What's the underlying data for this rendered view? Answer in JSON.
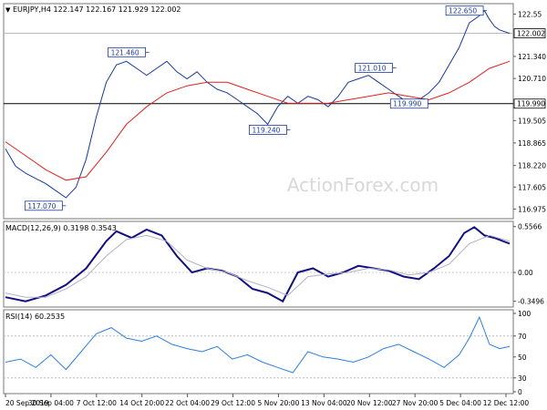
{
  "chart_data": [
    {
      "type": "line",
      "panel": "price",
      "title": "EURJPY,H4  122.147 122.167 121.929 122.002",
      "watermark": "ActionForex.com",
      "ylim": [
        116.7,
        122.85
      ],
      "y_ticks": [
        "122.55",
        "121.340",
        "120.710",
        "119.505",
        "118.865",
        "118.220",
        "117.605",
        "116.975"
      ],
      "y_tick_values": [
        122.55,
        121.34,
        120.71,
        119.505,
        118.865,
        118.22,
        117.605,
        116.975
      ],
      "current_price": "122.002",
      "horizontal_line": "119.990",
      "annotations": [
        {
          "label": "121.460",
          "x": 0.285,
          "value": 121.46
        },
        {
          "label": "117.070",
          "x": 0.12,
          "value": 117.07
        },
        {
          "label": "119.240",
          "x": 0.565,
          "value": 119.24
        },
        {
          "label": "121.010",
          "x": 0.775,
          "value": 121.01
        },
        {
          "label": "119.990",
          "x": 0.845,
          "value": 119.99
        },
        {
          "label": "122.650",
          "x": 0.955,
          "value": 122.65
        }
      ],
      "series": [
        {
          "color": "#1a3a9a",
          "x": [
            0,
            0.02,
            0.04,
            0.06,
            0.08,
            0.1,
            0.12,
            0.14,
            0.16,
            0.18,
            0.2,
            0.22,
            0.24,
            0.26,
            0.28,
            0.3,
            0.32,
            0.34,
            0.36,
            0.38,
            0.4,
            0.42,
            0.44,
            0.46,
            0.48,
            0.5,
            0.52,
            0.54,
            0.56,
            0.58,
            0.6,
            0.62,
            0.64,
            0.66,
            0.68,
            0.7,
            0.72,
            0.74,
            0.76,
            0.78,
            0.8,
            0.82,
            0.84,
            0.86,
            0.88,
            0.9,
            0.92,
            0.94,
            0.95,
            0.96,
            0.97,
            0.98,
            1.0
          ],
          "values": [
            118.7,
            118.2,
            118.0,
            117.85,
            117.7,
            117.5,
            117.3,
            117.6,
            118.4,
            119.6,
            120.6,
            121.1,
            121.2,
            121.0,
            120.8,
            121.0,
            121.2,
            120.9,
            120.7,
            120.9,
            120.6,
            120.4,
            120.3,
            120.1,
            119.9,
            119.7,
            119.4,
            119.9,
            120.2,
            120.0,
            120.2,
            120.1,
            119.9,
            120.2,
            120.6,
            120.7,
            120.8,
            120.6,
            120.4,
            120.2,
            120.0,
            120.1,
            120.3,
            120.6,
            121.1,
            121.6,
            122.3,
            122.5,
            122.65,
            122.4,
            122.2,
            122.1,
            122.0
          ]
        },
        {
          "color": "#e02020",
          "x": [
            0,
            0.04,
            0.08,
            0.12,
            0.16,
            0.2,
            0.24,
            0.28,
            0.32,
            0.36,
            0.4,
            0.44,
            0.48,
            0.52,
            0.56,
            0.6,
            0.64,
            0.68,
            0.72,
            0.76,
            0.8,
            0.84,
            0.88,
            0.92,
            0.96,
            1.0
          ],
          "values": [
            118.9,
            118.5,
            118.1,
            117.8,
            117.9,
            118.6,
            119.4,
            119.9,
            120.3,
            120.5,
            120.6,
            120.6,
            120.4,
            120.2,
            120.0,
            120.0,
            120.0,
            120.1,
            120.2,
            120.3,
            120.2,
            120.1,
            120.3,
            120.6,
            121.0,
            121.2
          ]
        }
      ]
    },
    {
      "type": "line",
      "panel": "macd",
      "title": "MACD(12,26,9) 0.3198 0.3543",
      "ylim": [
        -0.42,
        0.62
      ],
      "y_ticks": [
        "0.5566",
        "0.00",
        "-0.3496"
      ],
      "y_tick_values": [
        0.5566,
        0.0,
        -0.3496
      ],
      "series": [
        {
          "color": "#101080",
          "x": [
            0,
            0.04,
            0.08,
            0.12,
            0.16,
            0.2,
            0.22,
            0.25,
            0.28,
            0.31,
            0.34,
            0.37,
            0.4,
            0.43,
            0.46,
            0.49,
            0.52,
            0.55,
            0.58,
            0.61,
            0.64,
            0.67,
            0.7,
            0.73,
            0.76,
            0.79,
            0.82,
            0.85,
            0.88,
            0.91,
            0.93,
            0.95,
            0.97,
            1.0
          ],
          "values": [
            -0.3,
            -0.35,
            -0.28,
            -0.15,
            0.05,
            0.38,
            0.5,
            0.42,
            0.52,
            0.45,
            0.2,
            0.0,
            0.05,
            0.02,
            -0.05,
            -0.2,
            -0.25,
            -0.35,
            0.0,
            0.05,
            -0.05,
            0.0,
            0.08,
            0.05,
            0.02,
            -0.05,
            -0.08,
            0.05,
            0.2,
            0.48,
            0.55,
            0.45,
            0.42,
            0.35
          ]
        },
        {
          "color": "#b0b0c8",
          "x": [
            0,
            0.04,
            0.08,
            0.12,
            0.16,
            0.2,
            0.24,
            0.28,
            0.32,
            0.36,
            0.4,
            0.44,
            0.48,
            0.52,
            0.56,
            0.6,
            0.64,
            0.68,
            0.72,
            0.76,
            0.8,
            0.84,
            0.88,
            0.92,
            0.96,
            1.0
          ],
          "values": [
            -0.25,
            -0.3,
            -0.3,
            -0.2,
            -0.05,
            0.2,
            0.4,
            0.45,
            0.38,
            0.15,
            0.05,
            0.0,
            -0.1,
            -0.18,
            -0.28,
            -0.05,
            -0.02,
            0.0,
            0.05,
            0.03,
            -0.03,
            0.0,
            0.1,
            0.35,
            0.45,
            0.38
          ]
        }
      ]
    },
    {
      "type": "line",
      "panel": "rsi",
      "title": "RSI(14) 60.2535",
      "ylim": [
        15,
        95
      ],
      "y_ticks": [
        "100",
        "70",
        "50",
        "30",
        "0"
      ],
      "y_tick_values": [
        100,
        70,
        50,
        30,
        0
      ],
      "series": [
        {
          "color": "#2b7fe0",
          "x": [
            0,
            0.03,
            0.06,
            0.09,
            0.12,
            0.15,
            0.18,
            0.21,
            0.24,
            0.27,
            0.3,
            0.33,
            0.36,
            0.39,
            0.42,
            0.45,
            0.48,
            0.51,
            0.54,
            0.57,
            0.6,
            0.63,
            0.66,
            0.69,
            0.72,
            0.75,
            0.78,
            0.81,
            0.84,
            0.87,
            0.9,
            0.92,
            0.94,
            0.95,
            0.96,
            0.98,
            1.0
          ],
          "values": [
            45,
            48,
            40,
            52,
            38,
            55,
            72,
            78,
            68,
            65,
            70,
            62,
            58,
            55,
            60,
            48,
            52,
            45,
            40,
            35,
            55,
            50,
            48,
            45,
            50,
            58,
            62,
            55,
            48,
            40,
            52,
            68,
            88,
            75,
            62,
            58,
            60
          ]
        }
      ]
    }
  ],
  "x_axis_labels": [
    "20 Sep 2019",
    "30 Sep 04:00",
    "7 Oct 12:00",
    "14 Oct 20:00",
    "22 Oct 04:00",
    "29 Oct 12:00",
    "5 Nov 20:00",
    "13 Nov 04:00",
    "20 Nov 12:00",
    "27 Nov 20:00",
    "5 Dec 04:00",
    "12 Dec 12:00"
  ],
  "colors": {
    "price_line": "#1a3a9a",
    "moving_average": "#e02020",
    "macd_line": "#101080",
    "signal_line": "#b0b0c8",
    "rsi_line": "#2b7fe0",
    "watermark": "#d8d8d8"
  }
}
